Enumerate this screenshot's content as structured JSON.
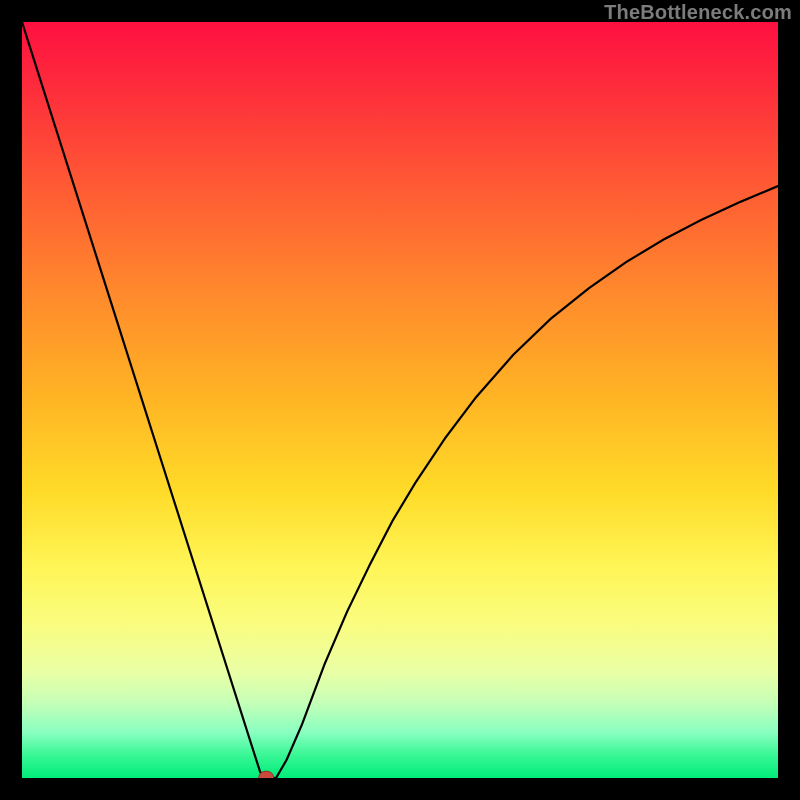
{
  "watermark": "TheBottleneck.com",
  "colors": {
    "frame": "#000000",
    "gradient_top": "#fe1040",
    "gradient_bottom": "#00ec79",
    "curve": "#000000",
    "marker_fill": "#c84a3c",
    "marker_stroke": "#8c2d22"
  },
  "chart_data": {
    "type": "line",
    "title": "",
    "xlabel": "",
    "ylabel": "",
    "xlim": [
      0,
      100
    ],
    "ylim": [
      0,
      100
    ],
    "grid": false,
    "series": [
      {
        "name": "curve",
        "x": [
          0,
          2,
          4,
          6,
          8,
          10,
          12,
          14,
          16,
          18,
          20,
          22,
          24,
          26,
          28,
          30,
          31.5,
          32.3,
          33.6,
          35,
          37,
          40,
          43,
          46,
          49,
          52,
          56,
          60,
          65,
          70,
          75,
          80,
          85,
          90,
          95,
          100
        ],
        "y": [
          100,
          93.7,
          87.4,
          81.1,
          74.8,
          68.5,
          62.2,
          55.9,
          49.6,
          43.3,
          37.0,
          30.7,
          24.4,
          18.1,
          11.8,
          5.5,
          0.8,
          0.0,
          0.0,
          2.4,
          7.0,
          15.0,
          22.0,
          28.2,
          34.0,
          39.0,
          45.0,
          50.3,
          56.0,
          60.8,
          64.8,
          68.3,
          71.3,
          73.9,
          76.2,
          78.3
        ]
      }
    ],
    "marker": {
      "x": 32.3,
      "y": 0.0,
      "rx": 1.0,
      "ry": 0.9
    }
  }
}
